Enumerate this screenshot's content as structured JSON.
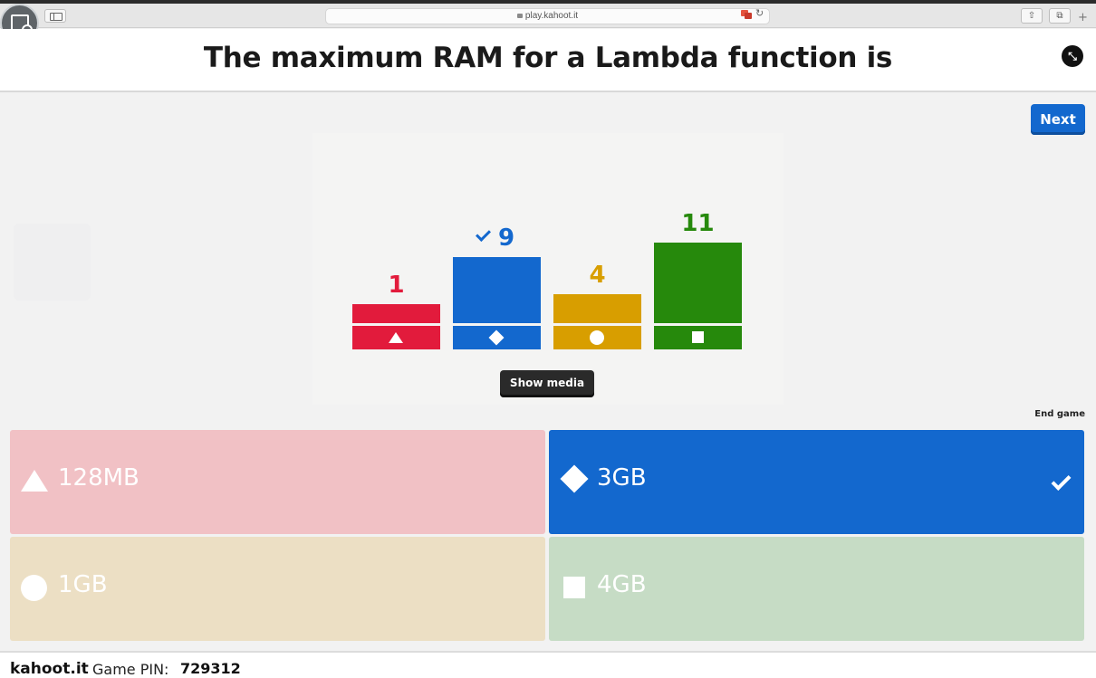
{
  "browser": {
    "url": "play.kahoot.it"
  },
  "question": {
    "title": "The maximum RAM for a Lambda function is"
  },
  "controls": {
    "next_label": "Next",
    "show_media_label": "Show media",
    "end_game_label": "End game"
  },
  "chart_data": {
    "type": "bar",
    "categories": [
      "128MB",
      "3GB",
      "1GB",
      "4GB"
    ],
    "values": [
      1,
      9,
      4,
      11
    ],
    "correct_index": 1,
    "colors": [
      "#e21b3c",
      "#1368ce",
      "#d89e00",
      "#26890c"
    ],
    "shapes": [
      "triangle-icon",
      "diamond-icon",
      "circle-icon",
      "square-icon"
    ]
  },
  "answers": [
    {
      "label": "128MB",
      "shape": "triangle-icon",
      "color": "#f1c1c5",
      "correct": false
    },
    {
      "label": "3GB",
      "shape": "diamond-icon",
      "color": "#1368ce",
      "correct": true
    },
    {
      "label": "1GB",
      "shape": "circle-icon",
      "color": "#ecdfc4",
      "correct": false
    },
    {
      "label": "4GB",
      "shape": "square-icon",
      "color": "#c6dcc5",
      "correct": false
    }
  ],
  "footer": {
    "brand": "kahoot.it",
    "pin_label": "Game PIN:",
    "pin": "729312"
  }
}
